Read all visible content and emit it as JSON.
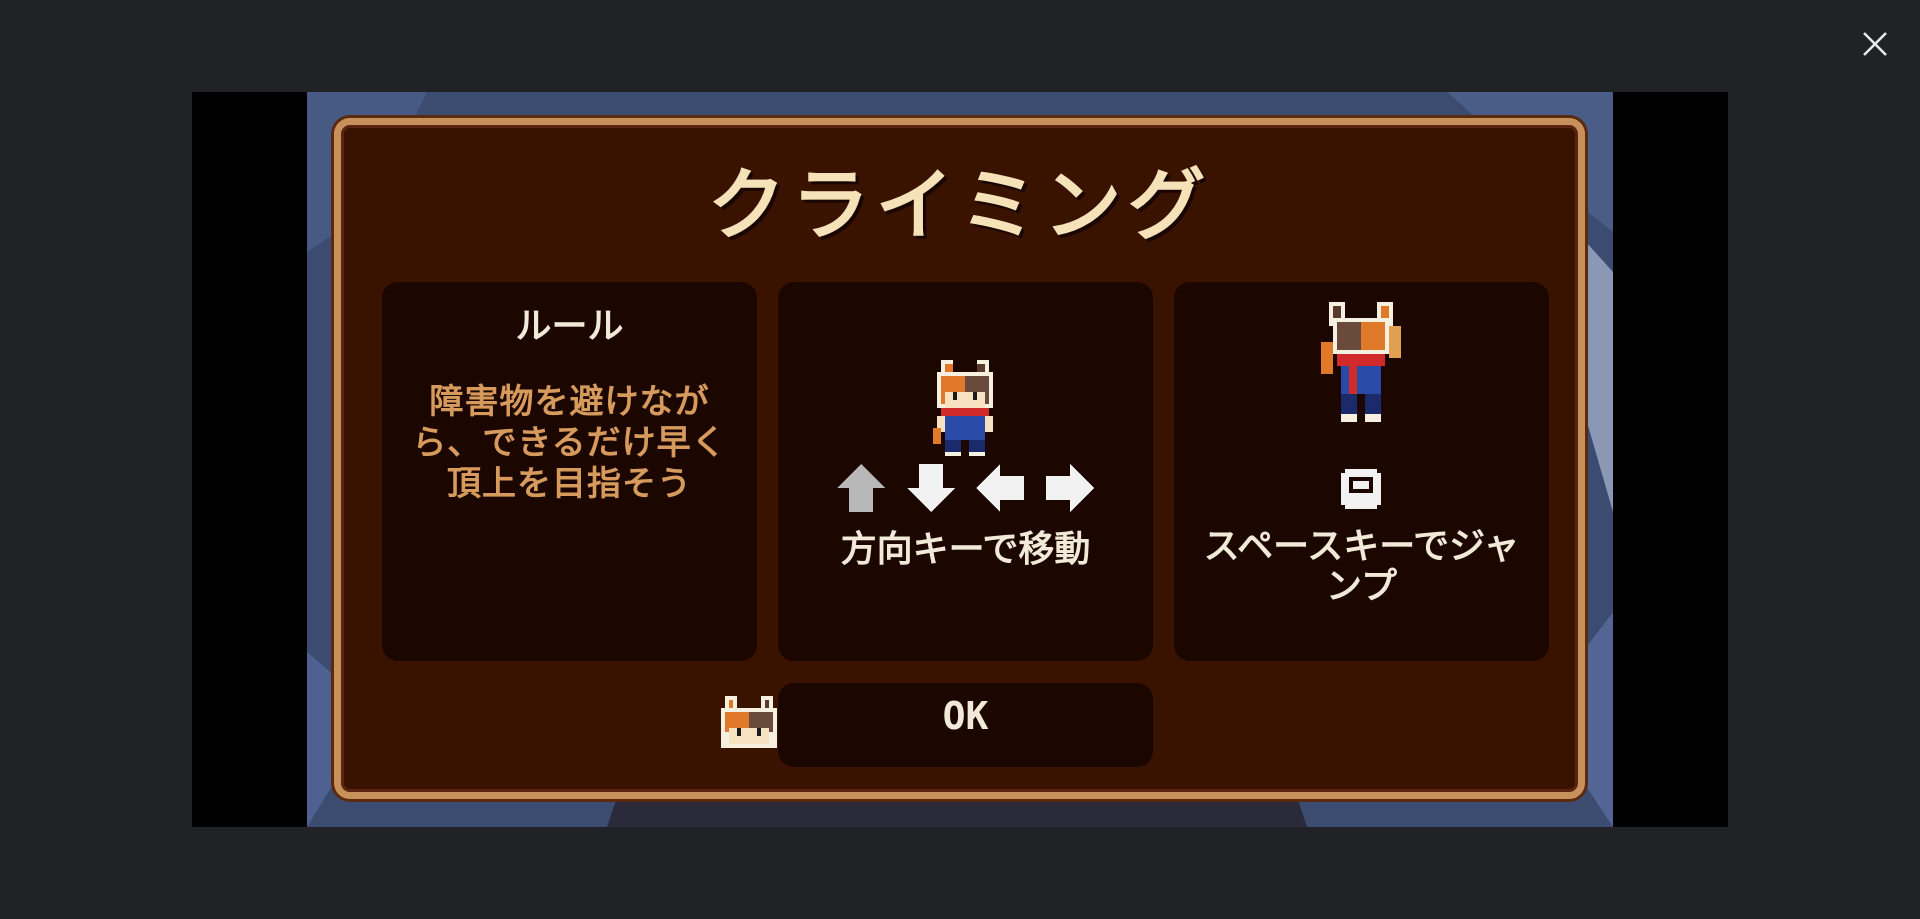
{
  "viewer": {
    "close_icon": "close-icon"
  },
  "game": {
    "title": "クライミング",
    "rule_panel": {
      "heading": "ルール",
      "text": "障害物を避けながら、できるだけ早く頂上を目指そう"
    },
    "move_panel": {
      "icons": [
        "arrow-up-icon",
        "arrow-down-icon",
        "arrow-left-icon",
        "arrow-right-icon"
      ],
      "label": "方向キーで移動"
    },
    "jump_panel": {
      "icon": "space-key-icon",
      "label": "スペースキーでジャンプ"
    },
    "ok_button": {
      "label": "OK"
    },
    "colors": {
      "dialog_bg": "#3a1200",
      "dialog_border": "#c8905a",
      "panel_bg": "#1c0600",
      "title_text": "#f6e2b8",
      "rule_text": "#d59a5c",
      "label_text": "#f2ead8"
    }
  }
}
